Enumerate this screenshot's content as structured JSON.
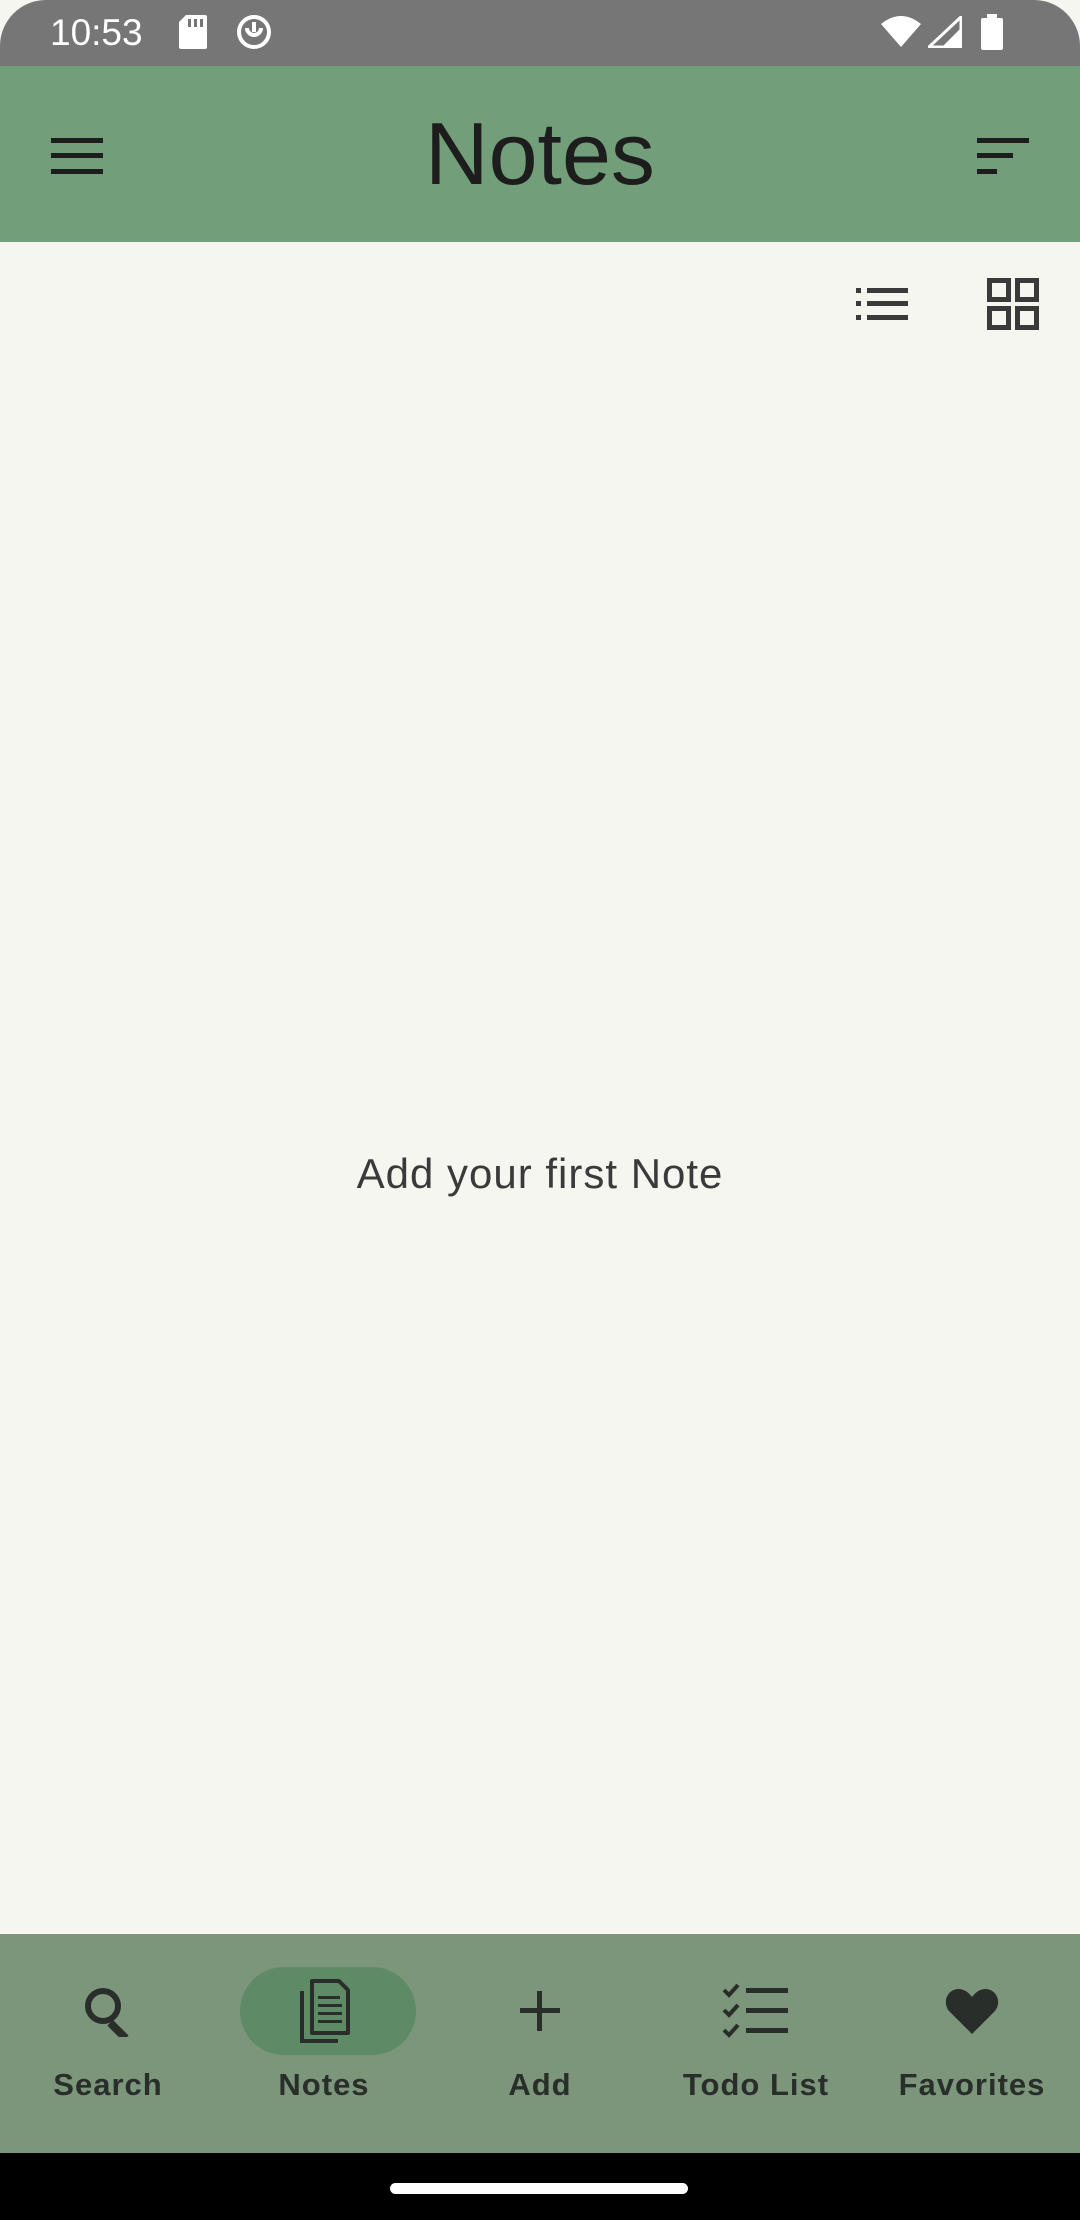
{
  "status_bar": {
    "time": "10:53",
    "left_icons": [
      "sd-card-icon",
      "sync-icon"
    ],
    "right_icons": [
      "wifi-icon",
      "cellular-signal-icon",
      "battery-icon"
    ]
  },
  "app_bar": {
    "title": "Notes",
    "menu_icon": "hamburger-menu-icon",
    "sort_icon": "sort-icon"
  },
  "view_toggle": {
    "list_icon": "list-view-icon",
    "grid_icon": "grid-view-icon"
  },
  "main": {
    "empty_message": "Add your first Note"
  },
  "bottom_nav": {
    "items": [
      {
        "label": "Search",
        "icon": "search-icon",
        "selected": false
      },
      {
        "label": "Notes",
        "icon": "notes-icon",
        "selected": true
      },
      {
        "label": "Add",
        "icon": "add-icon",
        "selected": false
      },
      {
        "label": "Todo List",
        "icon": "todo-list-icon",
        "selected": false
      },
      {
        "label": "Favorites",
        "icon": "heart-icon",
        "selected": false
      }
    ]
  },
  "colors": {
    "app_bar": "#739E7A",
    "background": "#F6F6F0",
    "bottom_nav": "#7C967C",
    "selected_pill": "#5E8A66",
    "status_bar": "#767676"
  }
}
